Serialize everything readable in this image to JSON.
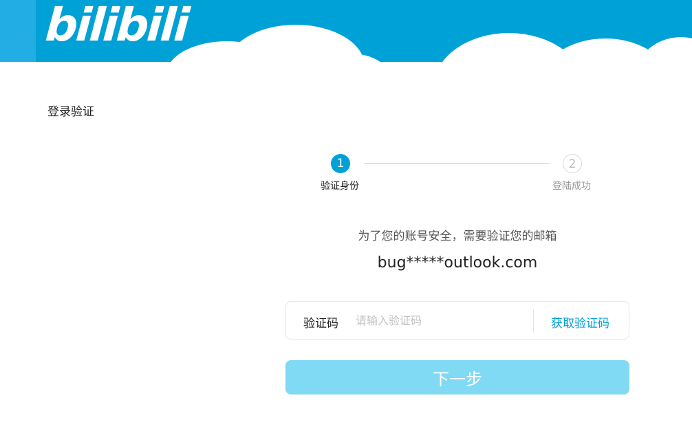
{
  "header": {
    "logo_text": "bilibili",
    "bg_color": "#00a1d6"
  },
  "page": {
    "title": "登录验证"
  },
  "steps": [
    {
      "number": "1",
      "label": "验证身份",
      "active": true
    },
    {
      "number": "2",
      "label": "登陆成功",
      "active": false
    }
  ],
  "verify": {
    "hint": "为了您的账号安全，需要验证您的邮箱",
    "email": "bug*****outlook.com",
    "code_label": "验证码",
    "code_value": "",
    "code_placeholder": "请输入验证码",
    "get_code_label": "获取验证码",
    "next_label": "下一步"
  },
  "colors": {
    "accent": "#00a1d6",
    "button_disabled": "#80daf3"
  }
}
